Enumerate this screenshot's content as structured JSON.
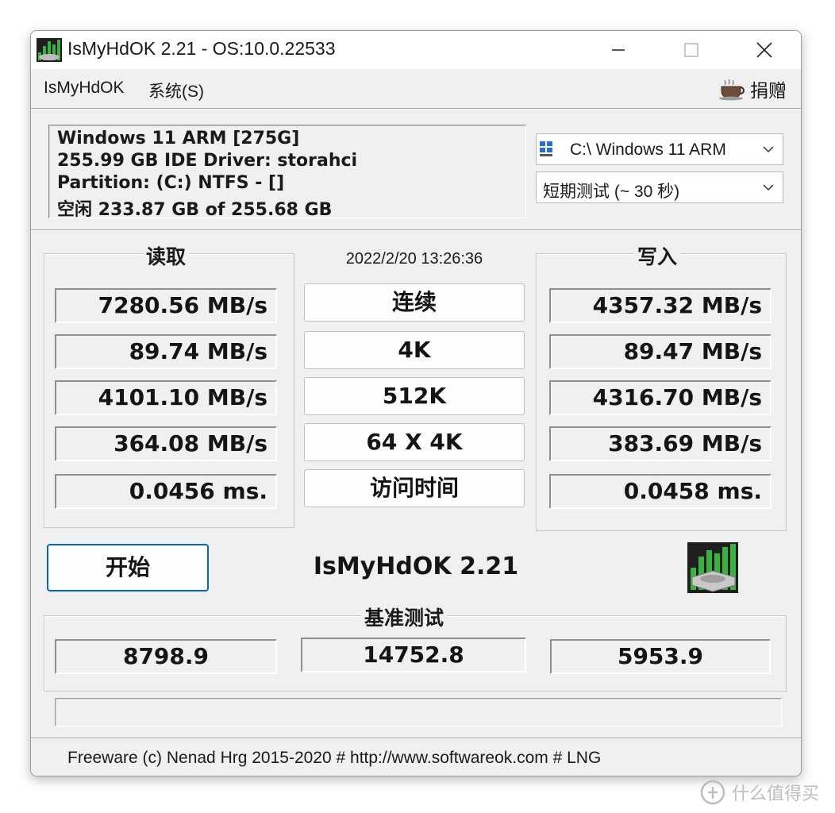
{
  "window": {
    "title": "IsMyHdOK 2.21 - OS:10.0.22533",
    "minimize_icon": "minimize-icon",
    "maximize_icon": "maximize-icon",
    "close_icon": "close-icon"
  },
  "menu": {
    "items": [
      "IsMyHdOK",
      "系统(S)"
    ],
    "donate_label": "捐赠",
    "donate_icon": "coffee-cup-icon"
  },
  "drive_info": {
    "lines": [
      "Windows 11 ARM [275G]",
      "255.99 GB  IDE Driver: storahci",
      "Partition: (C:) NTFS - []",
      "空闲 233.87 GB of 255.68 GB"
    ]
  },
  "drive_select": {
    "value": "C:\\ Windows 11 ARM",
    "icon": "drive-icon"
  },
  "duration_select": {
    "value": "短期测试 (~ 30 秒)"
  },
  "read": {
    "title": "读取",
    "values": [
      "7280.56 MB/s",
      "89.74 MB/s",
      "4101.10 MB/s",
      "364.08 MB/s",
      "0.0456 ms."
    ]
  },
  "write": {
    "title": "写入",
    "values": [
      "4357.32 MB/s",
      "89.47 MB/s",
      "4316.70 MB/s",
      "383.69 MB/s",
      "0.0458 ms."
    ]
  },
  "timestamp": "2022/2/20 13:26:36",
  "tests": [
    "连续",
    "4K",
    "512K",
    "64 X 4K",
    "访问时间"
  ],
  "start_button": "开始",
  "app_name": "IsMyHdOK 2.21",
  "benchmark": {
    "title": "基准测试",
    "values": [
      "8798.9",
      "14752.8",
      "5953.9"
    ]
  },
  "progress": 0,
  "footer": "Freeware (c) Nenad Hrg 2015-2020 # http://www.softwareok.com      # LNG",
  "watermark": {
    "icon": "zhi-logo-icon",
    "text": "什么值得买"
  },
  "colors": {
    "accent": "#0067c0",
    "chart_green": "#3cb043"
  }
}
